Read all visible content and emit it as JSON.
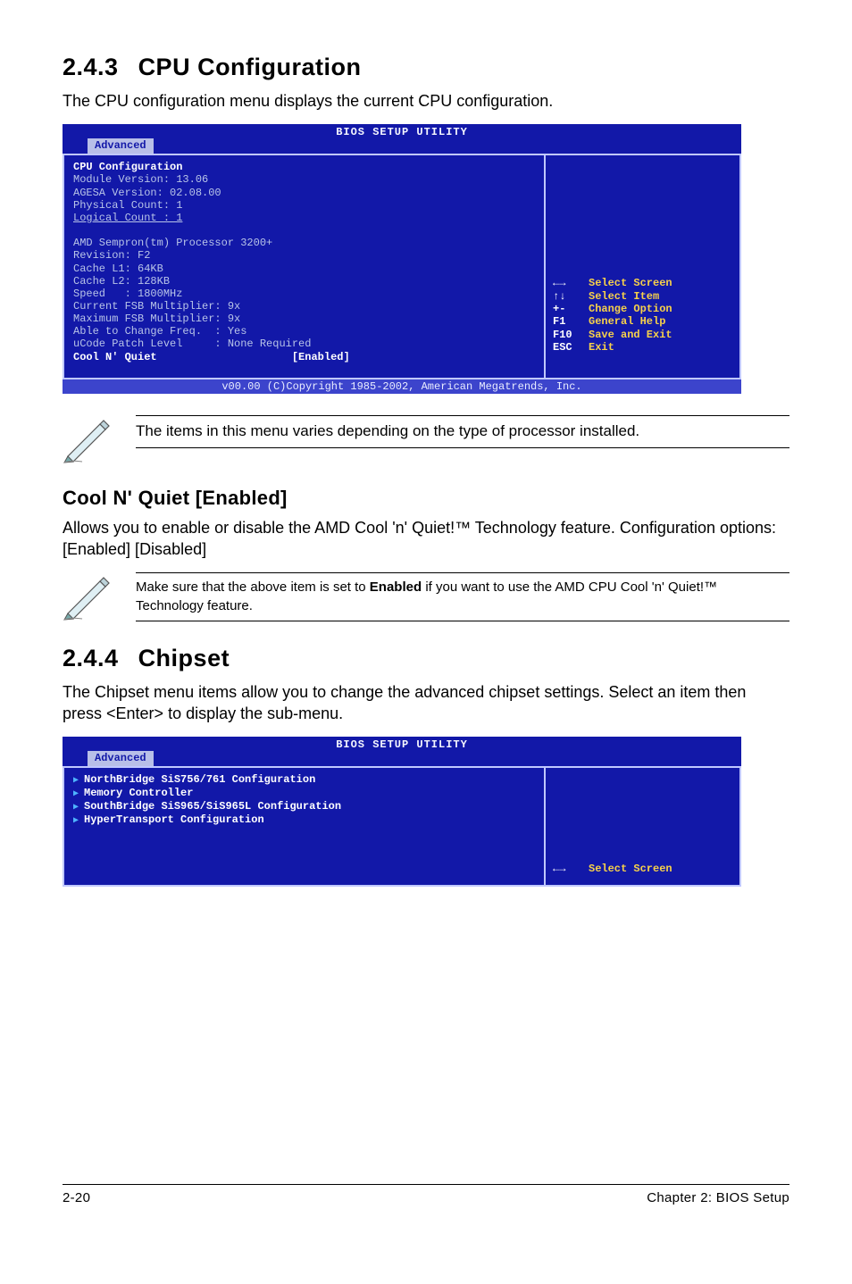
{
  "section_243": {
    "number": "2.4.3",
    "title": "CPU Configuration",
    "intro": "The CPU configuration menu displays the current CPU configuration."
  },
  "bios1": {
    "title": "BIOS SETUP UTILITY",
    "tab": "Advanced",
    "block_title": "CPU Configuration",
    "lines_top": [
      "Module Version: 13.06",
      "AGESA Version: 02.08.00",
      "Physical Count: 1",
      "Logical Count : 1"
    ],
    "lines_mid": [
      "AMD Sempron(tm) Processor 3200+",
      "Revision: F2",
      "Cache L1: 64KB",
      "Cache L2: 128KB",
      "Speed   : 1800MHz",
      "Current FSB Multiplier: 9x",
      "Maximum FSB Multiplier: 9x",
      "Able to Change Freq.  : Yes",
      "uCode Patch Level     : None Required"
    ],
    "option_label": "Cool N' Quiet",
    "option_value": "[Enabled]",
    "help": [
      {
        "key": "←→",
        "desc": "Select Screen"
      },
      {
        "key": "↑↓",
        "desc": "Select Item"
      },
      {
        "key": "+-",
        "desc": "Change Option"
      },
      {
        "key": "F1",
        "desc": "General Help"
      },
      {
        "key": "F10",
        "desc": "Save and Exit"
      },
      {
        "key": "ESC",
        "desc": "Exit"
      }
    ],
    "footer": "v00.00 (C)Copyright 1985-2002, American Megatrends, Inc."
  },
  "note1": "The items in this menu varies depending on the type of processor installed.",
  "cool_n_quiet": {
    "heading": "Cool N' Quiet [Enabled]",
    "body": "Allows you to enable or disable the AMD Cool 'n' Quiet!™ Technology feature. Configuration options: [Enabled] [Disabled]"
  },
  "note2_pre": "Make sure that the above item is set to ",
  "note2_bold": "Enabled",
  "note2_post": " if you want to use the AMD CPU Cool 'n' Quiet!™ Technology feature.",
  "section_244": {
    "number": "2.4.4",
    "title": "Chipset",
    "intro": "The Chipset menu items allow you to change the advanced chipset settings. Select an item then press <Enter> to display the sub-menu."
  },
  "bios2": {
    "title": "BIOS SETUP UTILITY",
    "tab": "Advanced",
    "items": [
      "NorthBridge SiS756/761 Configuration",
      "Memory Controller",
      "SouthBridge SiS965/SiS965L Configuration",
      "HyperTransport Configuration"
    ],
    "help": [
      {
        "key": "←→",
        "desc": "Select Screen"
      }
    ]
  },
  "footer": {
    "left": "2-20",
    "right": "Chapter 2: BIOS Setup"
  }
}
